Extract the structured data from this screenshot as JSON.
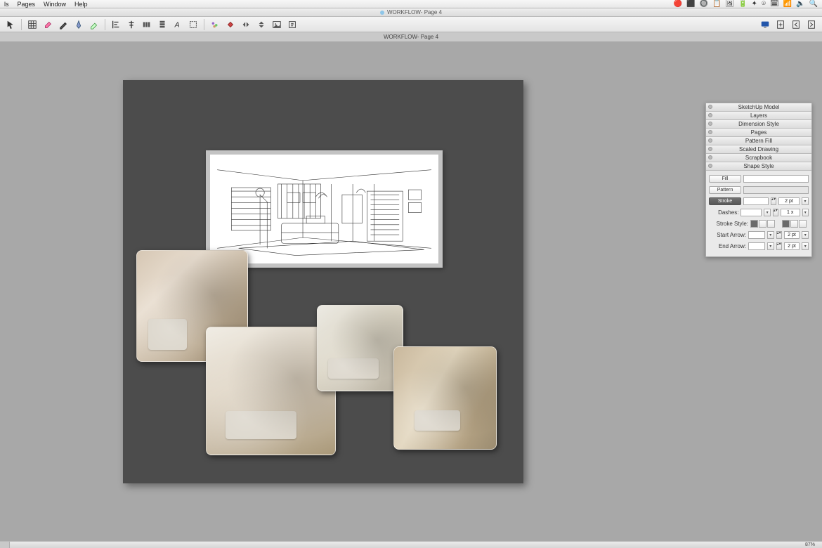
{
  "menubar": {
    "items": [
      "ls",
      "Pages",
      "Window",
      "Help"
    ]
  },
  "tray_icons": [
    "🔴",
    "⬛",
    "🔘",
    "📋",
    "🖼",
    "🔋",
    "✦",
    "⌾",
    "🗓",
    "📶",
    "🔈",
    "🔍"
  ],
  "window": {
    "title": "WORKFLOW- Page 4",
    "subtitle": "WORKFLOW- Page 4"
  },
  "toolbar": {
    "tools": [
      "select",
      "grid",
      "eraser",
      "pencil",
      "pen",
      "highlight",
      "align-left",
      "align-center",
      "dist-h",
      "dist-v",
      "text",
      "crop",
      "group",
      "bucket",
      "flip-h",
      "flip-v",
      "image",
      "export"
    ],
    "right_tools": [
      "display",
      "new-page",
      "prev-page",
      "next-page"
    ]
  },
  "inspector": {
    "sections": [
      "SketchUp Model",
      "Layers",
      "Dimension Style",
      "Pages",
      "Pattern Fill",
      "Scaled Drawing",
      "Scrapbook",
      "Shape Style"
    ],
    "fill_label": "Fill",
    "pattern_label": "Pattern",
    "stroke_label": "Stroke",
    "stroke_width": "2 pt",
    "dashes_label": "Dashes:",
    "dashes_scale": "1 x",
    "stroke_style_label": "Stroke Style:",
    "start_arrow_label": "Start Arrow:",
    "start_arrow_size": "2 pt",
    "end_arrow_label": "End Arrow:",
    "end_arrow_size": "2 pt"
  },
  "status": {
    "zoom": "87%"
  }
}
